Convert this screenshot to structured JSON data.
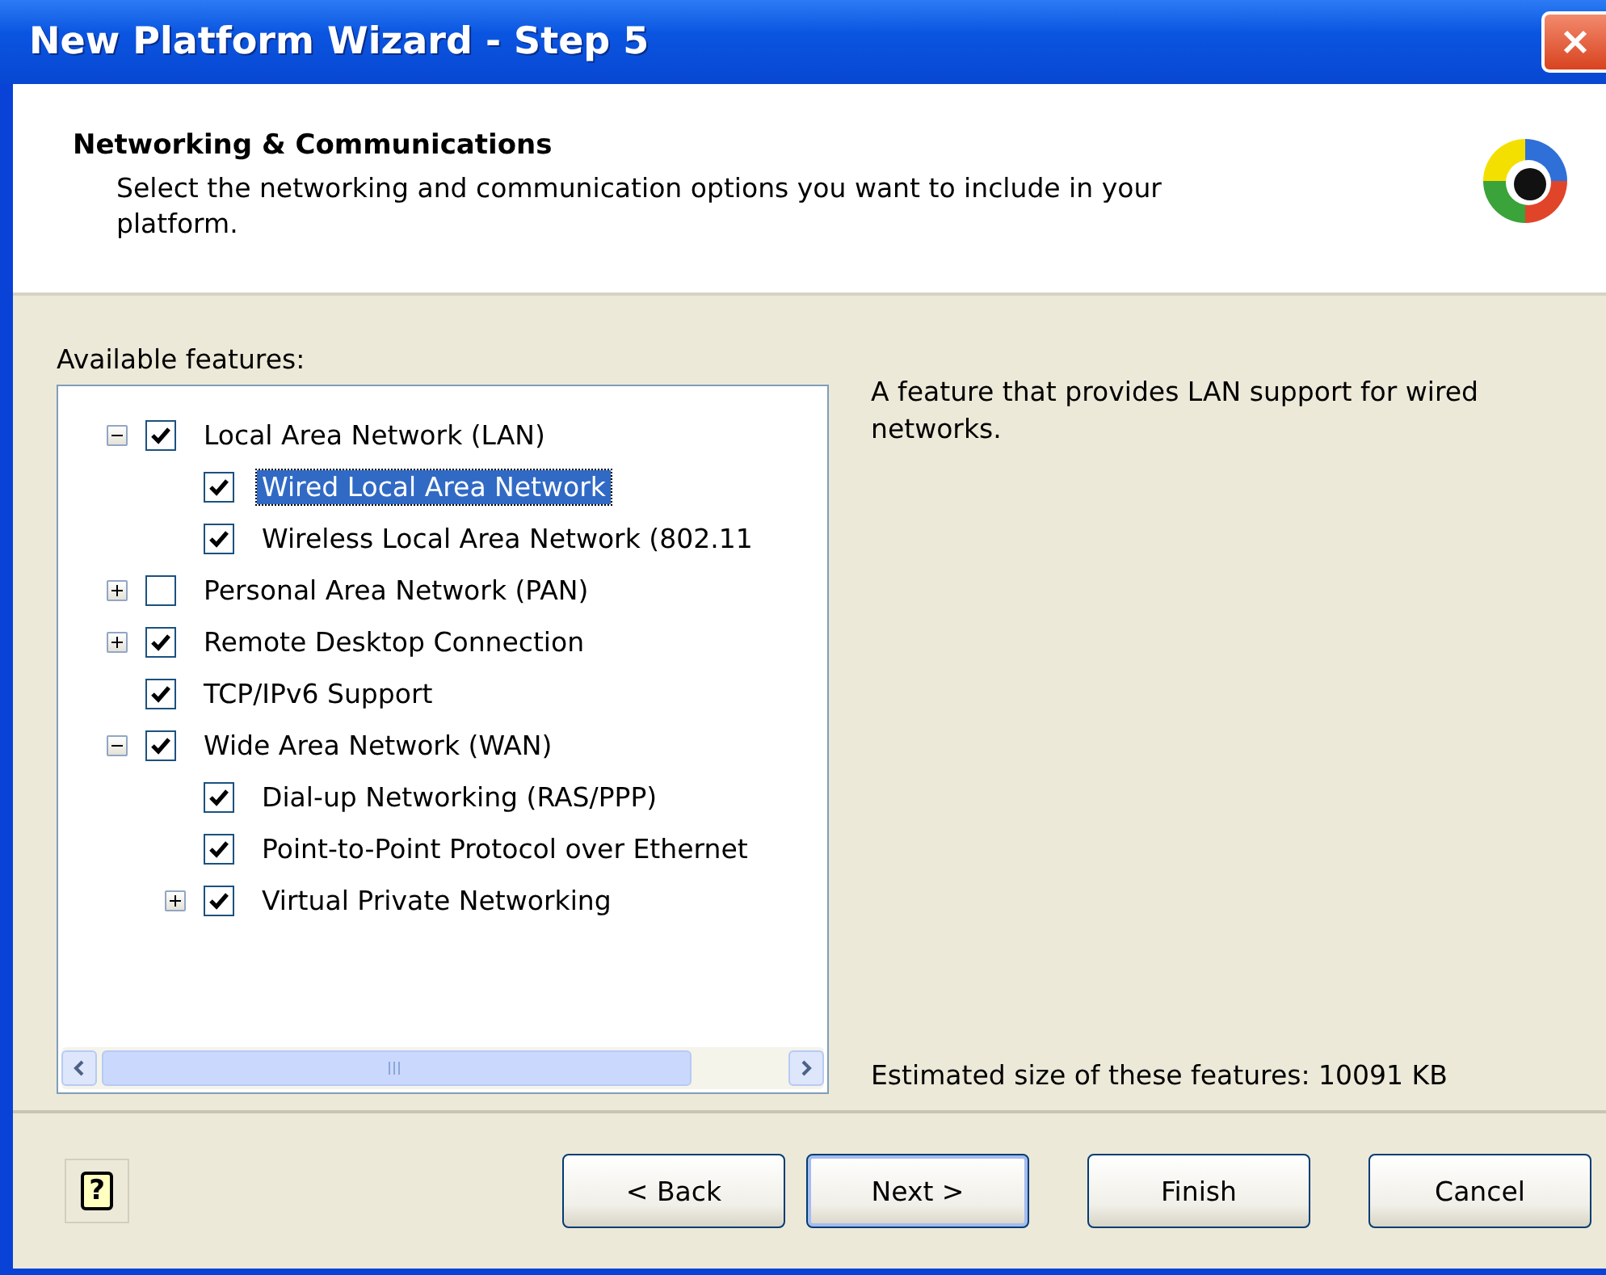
{
  "window": {
    "title": "New Platform Wizard - Step 5"
  },
  "header": {
    "title": "Networking & Communications",
    "description": "Select the networking and communication options you want to include in your platform."
  },
  "features": {
    "label": "Available features:",
    "items": [
      {
        "label": "Local Area Network (LAN)",
        "checked": true,
        "selected": false,
        "expanded": true,
        "children": [
          {
            "label": "Wired Local Area Network",
            "checked": true,
            "selected": true
          },
          {
            "label": "Wireless Local Area Network (802.11",
            "checked": true,
            "selected": false
          }
        ]
      },
      {
        "label": "Personal Area Network (PAN)",
        "checked": false,
        "selected": false,
        "expanded": false
      },
      {
        "label": "Remote Desktop Connection",
        "checked": true,
        "selected": false,
        "expanded": false
      },
      {
        "label": "TCP/IPv6 Support",
        "checked": true,
        "selected": false
      },
      {
        "label": "Wide Area Network (WAN)",
        "checked": true,
        "selected": false,
        "expanded": true,
        "children": [
          {
            "label": "Dial-up Networking (RAS/PPP)",
            "checked": true,
            "selected": false
          },
          {
            "label": "Point-to-Point Protocol over Ethernet",
            "checked": true,
            "selected": false
          },
          {
            "label": "Virtual Private Networking",
            "checked": true,
            "selected": false,
            "expanded": false
          }
        ]
      }
    ]
  },
  "description": "A feature that provides LAN support for wired networks.",
  "estimated_size": "Estimated size of these features: 10091 KB",
  "buttons": [
    {
      "kind": "help",
      "label": "?"
    },
    {
      "kind": "back",
      "label": "< Back"
    },
    {
      "kind": "next",
      "label": "Next >"
    },
    {
      "kind": "finish",
      "label": "Finish"
    },
    {
      "kind": "cancel",
      "label": "Cancel"
    }
  ]
}
